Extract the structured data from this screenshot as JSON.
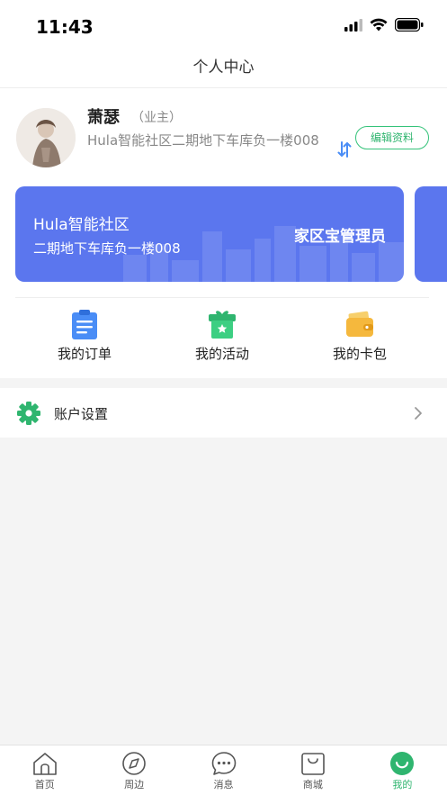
{
  "status_bar": {
    "time": "11:43"
  },
  "header": {
    "title": "个人中心"
  },
  "profile": {
    "name": "萧瑟",
    "role": "（业主）",
    "address": "Hula智能社区二期地下车库负一楼008",
    "edit_label": "编辑资料"
  },
  "community_card": {
    "name": "Hula智能社区",
    "address": "二期地下车库负一楼008",
    "role": "家区宝管理员"
  },
  "quick_actions": [
    {
      "label": "我的订单",
      "icon": "clipboard-icon"
    },
    {
      "label": "我的活动",
      "icon": "gift-box-icon"
    },
    {
      "label": "我的卡包",
      "icon": "wallet-icon"
    }
  ],
  "settings": {
    "label": "账户设置",
    "icon": "gear-icon"
  },
  "tabs": [
    {
      "label": "首页",
      "icon": "home-icon",
      "active": false
    },
    {
      "label": "周边",
      "icon": "compass-icon",
      "active": false
    },
    {
      "label": "消息",
      "icon": "message-icon",
      "active": false
    },
    {
      "label": "商城",
      "icon": "shopping-bag-icon",
      "active": false
    },
    {
      "label": "我的",
      "icon": "profile-icon",
      "active": true
    }
  ],
  "colors": {
    "accent_green": "#2fb56f",
    "card_blue": "#5b76ee",
    "order_icon_blue": "#4a8df6",
    "wallet_yellow": "#f5b83d"
  }
}
